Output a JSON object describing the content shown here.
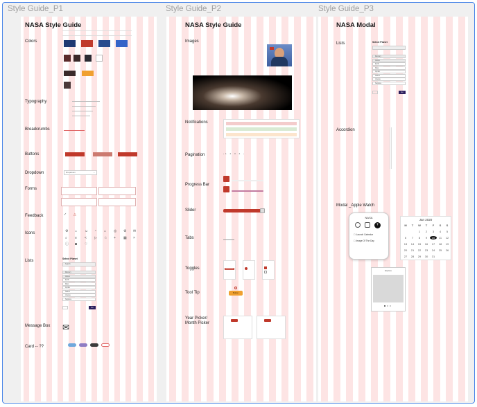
{
  "frames": [
    {
      "label": "Style Guide_P1",
      "title": "NASA Style Guide"
    },
    {
      "label": "Style Guide_P2",
      "title": "NASA Style Guide"
    },
    {
      "label": "Style Guide_P3",
      "title": "NASA Modal"
    }
  ],
  "p1": {
    "sections": {
      "colors": "Colors",
      "typography": "Typography",
      "breadcrumbs": "Breadcrumbs",
      "buttons": "Buttons",
      "dropdown": "Dropdown",
      "forms": "Forms",
      "feedback": "Feedback",
      "icons": "Icons",
      "lists": "Lists",
      "message_box": "Message Box",
      "card": "Card -- ??"
    },
    "colors": {
      "primary": [
        "#1f3a73",
        "#c0392b",
        "#2a4b8d",
        "#3564c8"
      ],
      "secondary": [
        "#5a2a2a",
        "#3b2a2a",
        "#2b2a32",
        "#ffffff"
      ],
      "accents": [
        "#3a2a2a",
        "#f0a030"
      ],
      "single": "#4a3838"
    },
    "buttons": [
      "Button",
      "Button",
      "Button"
    ],
    "dropdown_value": "Dropdown",
    "lists_title": "Select Planet",
    "list_search_placeholder": "Search",
    "list_items": [
      "Mercury",
      "Venus",
      "Earth",
      "Mars",
      "Jupiter",
      "Saturn",
      "Uranus",
      "Neptune"
    ],
    "list_button": "Go",
    "chip_colors": [
      "#6fa8dc",
      "#8e7cc3",
      "#3b3b3b",
      "#e06666"
    ]
  },
  "p2": {
    "sections": {
      "images": "Images",
      "notifications": "Notifications",
      "pagination": "Pagination",
      "progress": "Progress Bar",
      "slider": "Slider",
      "tabs": "Tabs",
      "toggles": "Toggles",
      "tooltip": "Tool Tip",
      "picker": "Year Picker/ Month Picker"
    },
    "tooltip_button": "Button",
    "notifications": [
      "#f4cccc",
      "#d9ead3",
      "#fce5cd"
    ]
  },
  "p3": {
    "sections": {
      "lists": "Lists",
      "accordion": "Accordion",
      "modal": "Modal _Apple Watch"
    },
    "lists_title": "Select Planet",
    "list_items": [
      "Mercury",
      "Venus",
      "Earth",
      "Mars",
      "Jupiter",
      "Saturn",
      "Uranus",
      "Neptune"
    ],
    "list_button": "Go",
    "watch_title": "NASA",
    "watch_options": [
      "Launch Calendar",
      "Image Of The Day"
    ],
    "calendar_title": "Jan 2020",
    "calendar_days": [
      "M",
      "T",
      "W",
      "T",
      "F",
      "S",
      "S"
    ],
    "calendar_dates": [
      [
        "",
        "",
        "1",
        "2",
        "3",
        "4",
        "5"
      ],
      [
        "6",
        "7",
        "8",
        "9",
        "10",
        "11",
        "12"
      ],
      [
        "13",
        "14",
        "15",
        "16",
        "17",
        "18",
        "19"
      ],
      [
        "20",
        "21",
        "22",
        "23",
        "24",
        "25",
        "26"
      ],
      [
        "27",
        "28",
        "29",
        "30",
        "31",
        "",
        ""
      ]
    ],
    "gallery_title": "Explore"
  }
}
